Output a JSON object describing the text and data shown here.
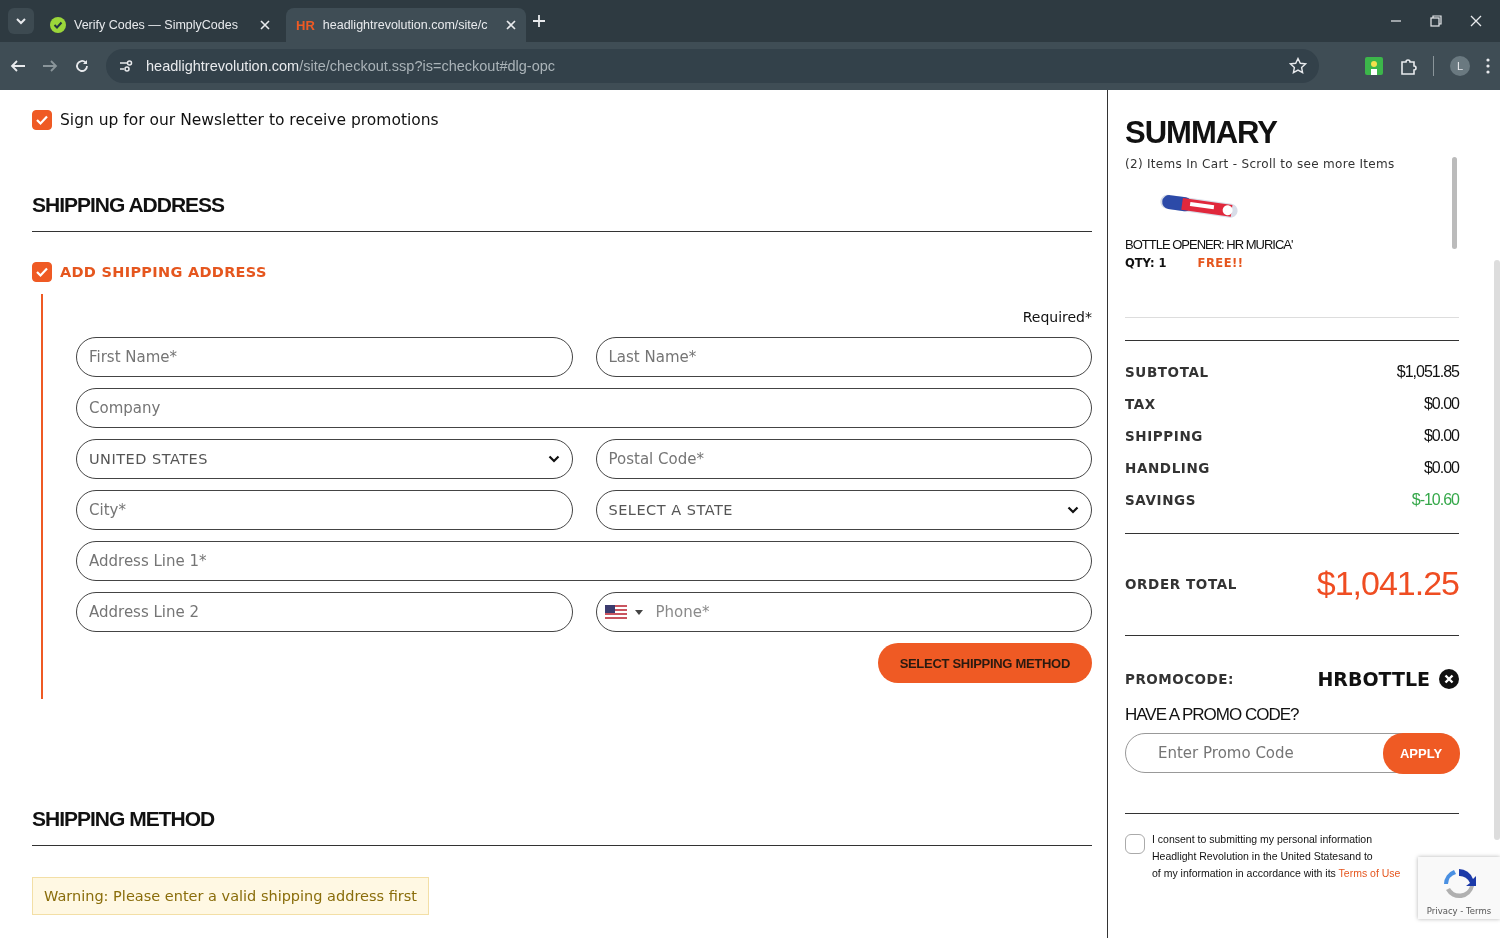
{
  "browser": {
    "tabs": [
      {
        "title": "Verify Codes — SimplyCodes",
        "selected": false
      },
      {
        "title": "headlightrevolution.com/site/c",
        "logo_text": "HR",
        "selected": true
      }
    ],
    "url_host": "headlightrevolution.com",
    "url_path": "/site/checkout.ssp?is=checkout#dlg-opc",
    "avatar": "L"
  },
  "newsletter": {
    "label": "Sign up for our Newsletter to receive promotions",
    "checked": true
  },
  "shipping_address": {
    "heading": "SHIPPING ADDRESS",
    "add": {
      "label": "ADD SHIPPING ADDRESS",
      "checked": true
    },
    "required_note": "Required*",
    "fields": [
      {
        "kind": "text",
        "placeholder": "First Name*"
      },
      {
        "kind": "text",
        "placeholder": "Last Name*"
      },
      {
        "kind": "wide",
        "placeholder": "Company"
      },
      {
        "kind": "select",
        "value": "UNITED STATES"
      },
      {
        "kind": "text",
        "placeholder": "Postal Code*"
      },
      {
        "kind": "text",
        "placeholder": "City*"
      },
      {
        "kind": "select",
        "value": "SELECT A STATE"
      },
      {
        "kind": "wide",
        "placeholder": "Address Line 1*"
      },
      {
        "kind": "text",
        "placeholder": "Address Line 2"
      },
      {
        "kind": "phone",
        "placeholder": "Phone*"
      }
    ],
    "submit": "SELECT SHIPPING METHOD"
  },
  "shipping_method": {
    "heading": "SHIPPING METHOD",
    "warning": "Warning: Please enter a valid shipping address first"
  },
  "summary": {
    "title": "SUMMARY",
    "cart_note": "(2) Items In Cart - Scroll to see more Items",
    "items": [
      {
        "kind": "picture",
        "name": "BOTTLE OPENER: HR MURICA'",
        "qty": "QTY: 1",
        "price": "FREE!!"
      }
    ],
    "totals": [
      {
        "label": "SUBTOTAL",
        "value": "$1,051.85",
        "kind": "normal"
      },
      {
        "label": "TAX",
        "value": "$0.00",
        "kind": "normal"
      },
      {
        "label": "SHIPPING",
        "value": "$0.00",
        "kind": "normal"
      },
      {
        "label": "HANDLING",
        "value": "$0.00",
        "kind": "normal"
      },
      {
        "label": "SAVINGS",
        "value": "$-10.60",
        "kind": "savings"
      }
    ],
    "order_total": {
      "label": "ORDER TOTAL",
      "value": "$1,041.25"
    },
    "promo": {
      "label": "PROMOCODE:",
      "code": "HRBOTTLE"
    },
    "promo_prompt": "HAVE A PROMO CODE?",
    "promo_field": {
      "placeholder": "Enter Promo Code"
    },
    "apply": "APPLY",
    "consent": {
      "checked": false,
      "lines": [
        "I consent to submitting my personal information",
        "Headlight Revolution in the United Statesand to",
        "of my information in accordance with its"
      ],
      "link": "Terms of Use"
    },
    "recaptcha": "Privacy - Terms"
  }
}
